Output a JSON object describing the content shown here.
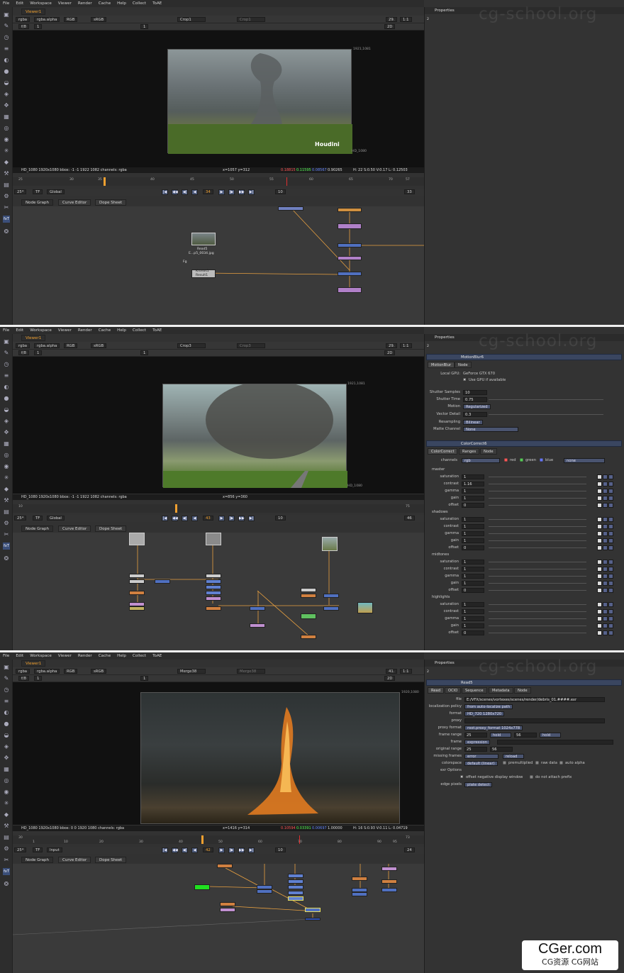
{
  "menu": [
    "File",
    "Edit",
    "Workspace",
    "Viewer",
    "Render",
    "Cache",
    "Help",
    "Collect",
    "ToAE"
  ],
  "watermark": "cg-school.org",
  "footer_brand": {
    "title": "CGer.com",
    "subtitle": "CG资源 CG网站"
  },
  "panels": [
    {
      "viewer_tab": "Viewer1",
      "channels": [
        "rgba",
        "rgba.alpha",
        "RGB",
        "sRGB"
      ],
      "input_a": "Crop1",
      "input_b": "Crop1",
      "zoom": "29.",
      "ratio": "1:1",
      "mode": "2D",
      "fstop": "f/8",
      "gain": "1",
      "gamma": "1",
      "res_label_top": "1921,1081",
      "res_label_bottom": "HD_1080",
      "logo_text": "Houdini",
      "info_left": "HD_1080 1920x1080  bbox: -1 -1 1922 1082 channels: rgba",
      "info_xy": "x=1057 y=312",
      "info_r": "0.18815",
      "info_g": "0.11595",
      "info_b": "0.08567",
      "info_a": "0.90265",
      "info_right": "H: 22 S:0.50 V:0.17  L: 0.12503",
      "timeline_start": "25",
      "timeline_end": "57",
      "ticks": [
        "25",
        "30",
        "35",
        "40",
        "45",
        "50",
        "55",
        "60",
        "65",
        "70"
      ],
      "fps": "25*",
      "tf": "TF",
      "range_mode": "Global",
      "current_frame": "34",
      "step": "10",
      "end_frame": "33",
      "graph_tabs": [
        "Node Graph",
        "Curve Editor",
        "Dope Sheet"
      ],
      "node_labels": [
        "Read5",
        "E...p5_0034.jpg",
        "Kronos1",
        "Result1",
        "Fg"
      ],
      "properties_title": "Properties",
      "properties_count": "2"
    },
    {
      "viewer_tab": "Viewer1",
      "channels": [
        "rgba",
        "rgba.alpha",
        "RGB",
        "sRGB"
      ],
      "input_a": "Crop3",
      "input_b": "Crop3",
      "zoom": "29.",
      "ratio": "1:1",
      "mode": "2D",
      "fstop": "f/8",
      "gain": "1",
      "gamma": "1",
      "res_label_top": "1921,1081",
      "res_label_bottom": "HD_1080",
      "info_left": "HD_1080 1920x1080  bbox: -1 -1 1922 1082 channels: rgba",
      "info_xy": "x=856 y=360",
      "timeline_start": "10",
      "timeline_end": "75",
      "fps": "25*",
      "tf": "TF",
      "range_mode": "Global",
      "current_frame": "43",
      "step": "10",
      "end_frame": "46",
      "graph_tabs": [
        "Node Graph",
        "Curve Editor",
        "Dope Sheet"
      ],
      "properties_title": "Properties",
      "properties_count": "2",
      "motionblur": {
        "name": "MotionBlur6",
        "tabs": [
          "MotionBlur",
          "Node"
        ],
        "local_gpu_label": "Local GPU:",
        "local_gpu_value": "GeForce GTX 670",
        "use_gpu": "Use GPU if available",
        "rows": [
          {
            "label": "Shutter Samples",
            "value": "10"
          },
          {
            "label": "Shutter Time",
            "value": "0.75"
          },
          {
            "label": "Motion",
            "value": "Regularized"
          },
          {
            "label": "Vector Detail",
            "value": "0.3"
          },
          {
            "label": "Resampling",
            "value": "Bilinear"
          },
          {
            "label": "Matte Channel",
            "value": "None"
          }
        ]
      },
      "colorcorrect": {
        "name": "ColorCorrect6",
        "tabs": [
          "ColorCorrect",
          "Ranges",
          "Node"
        ],
        "channels_label": "channels",
        "channels_value": "rgb",
        "channel_checks": [
          "red",
          "green",
          "blue"
        ],
        "channel_extra": "none",
        "sections": [
          {
            "name": "master",
            "rows": [
              {
                "label": "saturation",
                "value": "1"
              },
              {
                "label": "contrast",
                "value": "1.16"
              },
              {
                "label": "gamma",
                "value": "1"
              },
              {
                "label": "gain",
                "value": "1"
              },
              {
                "label": "offset",
                "value": "0"
              }
            ]
          },
          {
            "name": "shadows",
            "rows": [
              {
                "label": "saturation",
                "value": "1"
              },
              {
                "label": "contrast",
                "value": "1"
              },
              {
                "label": "gamma",
                "value": "1"
              },
              {
                "label": "gain",
                "value": "1"
              },
              {
                "label": "offset",
                "value": "0"
              }
            ]
          },
          {
            "name": "midtones",
            "rows": [
              {
                "label": "saturation",
                "value": "1"
              },
              {
                "label": "contrast",
                "value": "1"
              },
              {
                "label": "gamma",
                "value": "1"
              },
              {
                "label": "gain",
                "value": "1"
              },
              {
                "label": "offset",
                "value": "0"
              }
            ]
          },
          {
            "name": "highlights",
            "rows": [
              {
                "label": "saturation",
                "value": "1"
              },
              {
                "label": "contrast",
                "value": "1"
              },
              {
                "label": "gamma",
                "value": "1"
              },
              {
                "label": "gain",
                "value": "1"
              },
              {
                "label": "offset",
                "value": "0"
              }
            ]
          }
        ]
      }
    },
    {
      "viewer_tab": "Viewer1",
      "channels": [
        "rgba",
        "rgba.alpha",
        "RGB",
        "sRGB"
      ],
      "input_a": "Merge38",
      "input_b": "Merge38",
      "zoom": "41.",
      "ratio": "1:1",
      "mode": "2D",
      "fstop": "f/8",
      "gain": "1",
      "gamma": "1",
      "res_label_top": "1920,1080",
      "info_left": "HD_1080 1920x1080  bbox: 0 0 1920 1080 channels: rgba",
      "info_xy": "x=1416 y=314",
      "info_r": "0.10594",
      "info_g": "0.03391",
      "info_b": "0.00697",
      "info_a": "1.00000",
      "info_right": "H: 16 S:0.93 V:0.11  L: 0.04719",
      "timeline_start": "30",
      "timeline_end": "73",
      "ticks": [
        "1",
        "10",
        "20",
        "30",
        "40",
        "50",
        "60",
        "70",
        "80",
        "90",
        "95"
      ],
      "fps": "25*",
      "tf": "TF",
      "range_mode": "Input",
      "current_frame": "42",
      "step": "10",
      "end_frame": "24",
      "graph_tabs": [
        "Node Graph",
        "Curve Editor",
        "Dope Sheet"
      ],
      "properties_title": "Properties",
      "properties_count": "2",
      "read": {
        "name": "Read5",
        "tabs": [
          "Read",
          "OCIO",
          "Sequence",
          "Metadata",
          "Node"
        ],
        "file_label": "file",
        "file_value": "E:/VFX/scenes/vortexes/scenes/render/debris_01.####.exr",
        "localization_label": "localization policy",
        "localization_value": "from auto-localize path",
        "format_label": "format",
        "format_value": "HD_720 1280x720",
        "proxy_label": "proxy",
        "proxy_format_label": "proxy format",
        "proxy_format_value": "root.proxy_format 1024x778",
        "frame_range_label": "frame range",
        "frame_range_start": "25",
        "frame_range_start_mode": "hold",
        "frame_range_end": "56",
        "frame_range_end_mode": "hold",
        "frame_label": "frame",
        "frame_value": "expression",
        "original_range_label": "original range",
        "original_range_start": "25",
        "original_range_end": "56",
        "missing_label": "missing frames",
        "missing_value": "error",
        "reload_label": "reload",
        "colorspace_label": "colorspace",
        "colorspace_value": "default (linear)",
        "premultiplied": "premultiplied",
        "raw_data": "raw data",
        "auto_alpha": "auto alpha",
        "exr_options": "exr Options",
        "offset_negative": "offset negative display window",
        "no_prefix": "do not attach prefix",
        "edge_label": "edge pixels",
        "edge_value": "plate detect"
      }
    }
  ]
}
